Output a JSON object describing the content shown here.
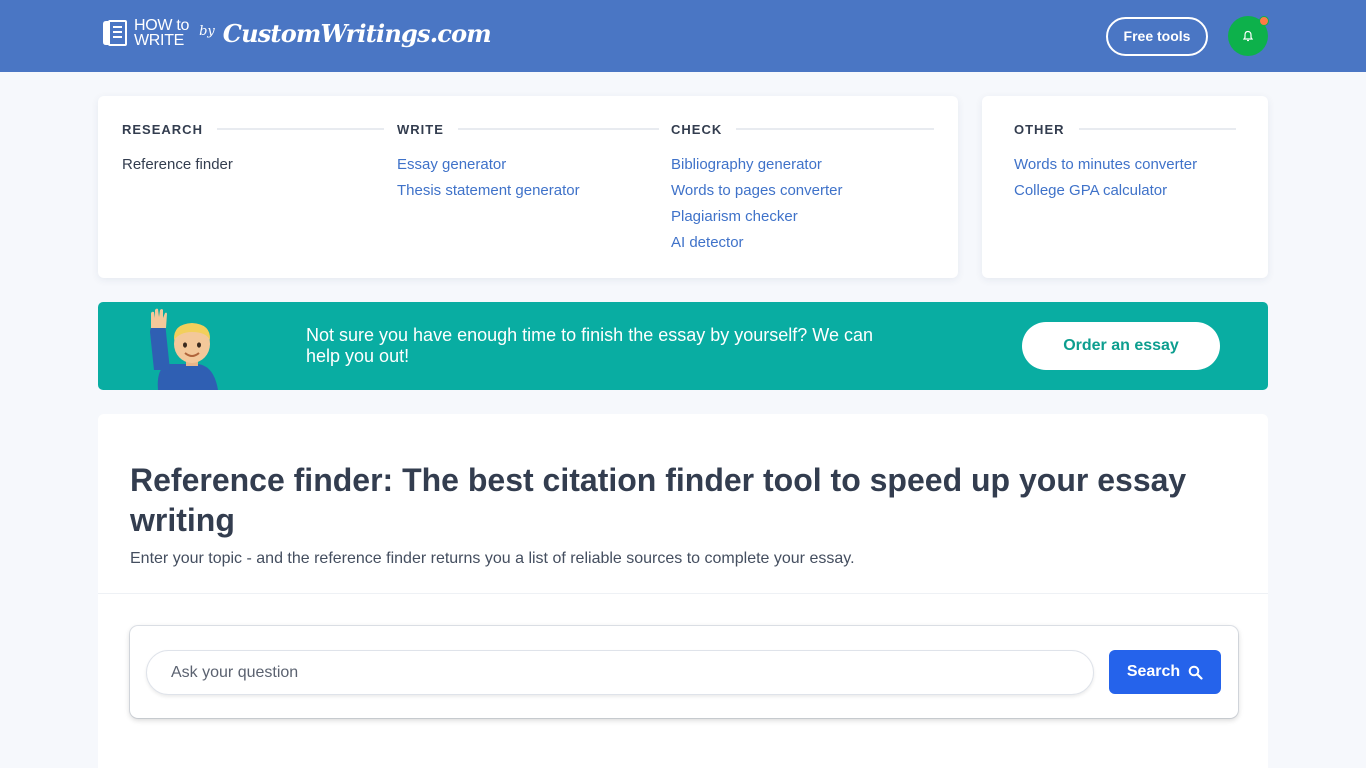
{
  "header": {
    "logo": {
      "howto_line1": "HOW to",
      "howto_line2": "WRITE",
      "by": "by",
      "brand": "CustomWritings.com"
    },
    "free_tools_label": "Free tools",
    "notification_icon": "bell-icon",
    "colors": {
      "header_bg": "#4a76c4",
      "notif_bg": "#0db14b",
      "notif_dot": "#ff7a45"
    }
  },
  "menu": {
    "columns": [
      {
        "heading": "RESEARCH",
        "links": [
          "Reference finder"
        ]
      },
      {
        "heading": "WRITE",
        "links": [
          "Essay generator",
          "Thesis statement generator"
        ]
      },
      {
        "heading": "CHECK",
        "links": [
          "Bibliography generator",
          "Words to pages converter",
          "Plagiarism checker",
          "AI detector"
        ]
      },
      {
        "heading": "OTHER",
        "links": [
          "Words to minutes converter",
          "College GPA calculator"
        ]
      }
    ],
    "link_color": "#3f72c9"
  },
  "banner": {
    "text": "Not sure you have enough time to finish the essay by yourself? We can help you out!",
    "button_label": "Order an essay",
    "icon": "raising-hand-person-icon",
    "bg_color": "#09ada2"
  },
  "main": {
    "title": "Reference finder: The best citation finder tool to speed up your essay writing",
    "subtitle": "Enter your topic - and the reference finder returns you a list of reliable sources to complete your essay.",
    "search": {
      "placeholder": "Ask your question",
      "value": "",
      "button_label": "Search",
      "button_icon": "search-icon",
      "button_color": "#2563eb"
    }
  }
}
